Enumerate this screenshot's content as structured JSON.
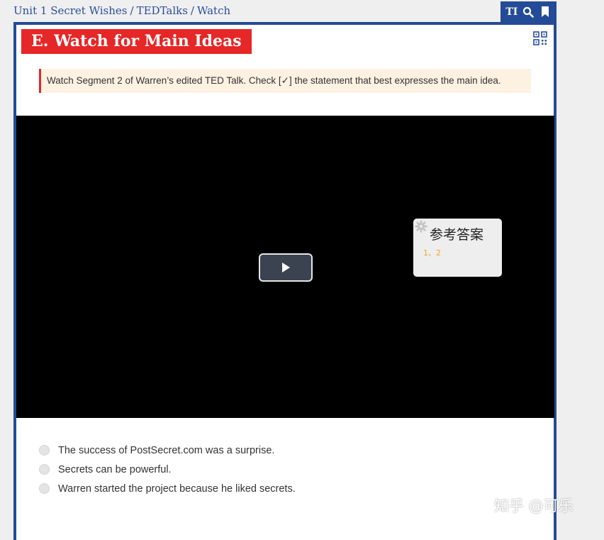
{
  "breadcrumb": {
    "items": [
      "Unit 1 Secret Wishes",
      "TEDTalks",
      "Watch"
    ],
    "separator": "/"
  },
  "toolbar": {
    "text_size_label": "TI",
    "icons": [
      "text-size-icon",
      "search-icon",
      "bookmark-icon"
    ]
  },
  "section": {
    "title": "E. Watch for Main Ideas",
    "instruction": "Watch Segment 2 of Warren’s edited TED Talk. Check [✓] the statement that best expresses the main idea."
  },
  "video": {
    "answer_overlay": {
      "heading": "参考答案",
      "value": "1、2"
    }
  },
  "options": [
    "The success of PostSecret.com was a surprise.",
    "Secrets can be powerful.",
    "Warren started the project because he liked secrets."
  ],
  "watermark": "知乎 @可乐",
  "colors": {
    "brand_blue": "#244b97",
    "title_red": "#e52727",
    "instruction_bg": "#fdf1e2",
    "answer_accent": "#f0a52b"
  }
}
